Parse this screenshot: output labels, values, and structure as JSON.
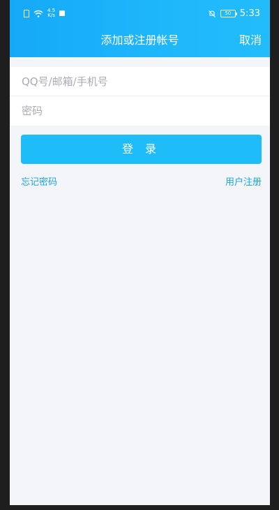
{
  "status_bar": {
    "speed": "4.5\nK/s",
    "battery": "50",
    "time": "5:33"
  },
  "header": {
    "title": "添加或注册帐号",
    "cancel_label": "取消"
  },
  "form": {
    "account_placeholder": "QQ号/邮箱/手机号",
    "password_placeholder": "密码",
    "login_label": "登 录"
  },
  "links": {
    "forgot_password": "忘记密码",
    "register": "用户注册"
  },
  "colors": {
    "accent": "#1ebcf9",
    "link": "#1aa5e8",
    "background": "#f4f5f9"
  }
}
